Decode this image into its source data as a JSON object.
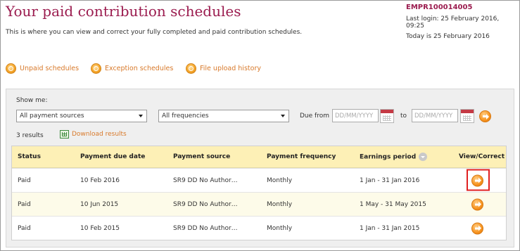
{
  "header": {
    "title": "Your paid contribution schedules",
    "intro": "This is where you can view and correct your fully completed and paid contribution schedules."
  },
  "account": {
    "reference": "EMPR100014005",
    "last_login": "Last login: 25 February 2016, 09:25",
    "today": "Today is 25 February 2016"
  },
  "links": {
    "unpaid": "Unpaid schedules",
    "exception": "Exception schedules",
    "history": "File upload history"
  },
  "filters": {
    "show_me": "Show me:",
    "source": "All payment sources",
    "frequency": "All frequencies",
    "due_from": "Due from",
    "to": "to",
    "date_placeholder": "DD/MM/YYYY"
  },
  "results": {
    "count": "3 results",
    "download": "Download results"
  },
  "table": {
    "headers": {
      "status": "Status",
      "due_date": "Payment due date",
      "source": "Payment source",
      "frequency": "Payment frequency",
      "earnings": "Earnings period",
      "view": "View/Correct"
    },
    "rows": [
      {
        "status": "Paid",
        "due_date": "10 Feb 2016",
        "source": "SR9 DD No Author…",
        "frequency": "Monthly",
        "earnings": "1 Jan - 31 Jan 2016"
      },
      {
        "status": "Paid",
        "due_date": "10 Jun 2015",
        "source": "SR9 DD No Author…",
        "frequency": "Monthly",
        "earnings": "1 May - 31 May 2015"
      },
      {
        "status": "Paid",
        "due_date": "10 Feb 2015",
        "source": "SR9 DD No Author…",
        "frequency": "Monthly",
        "earnings": "1 Jan - 31 Jan 2015"
      }
    ]
  },
  "colors": {
    "title": "#9b1c4f",
    "link": "#d8792a",
    "header_bg": "#fdf0b6",
    "highlight": "#e02020"
  },
  "icons": {
    "link": "magnifier-icon",
    "go": "arrow-right-circle-icon",
    "calendar": "calendar-icon",
    "download": "spreadsheet-icon",
    "sort": "sort-down-icon"
  }
}
